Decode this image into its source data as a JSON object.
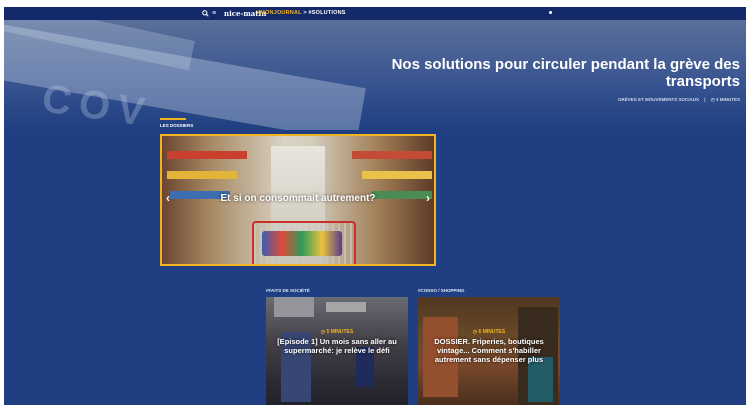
{
  "topbar": {
    "search_icon": "search-icon",
    "menu_icon": "menu-icon",
    "logo": "nice-matin",
    "crumb_primary": "#MONJOURNAL",
    "crumb_sep": ">",
    "crumb_secondary": "#SOLUTIONS"
  },
  "hero": {
    "title": "Nos solutions pour circuler pendant la grève des transports",
    "category": "GRÈVES ET MOUVEMENTS SOCIAUX",
    "clock_icon": "clock-icon",
    "read_time": "3 MINUTES",
    "background_word": "COV"
  },
  "section": {
    "label": "LES DOSSIERS"
  },
  "dossier": {
    "title": "Et si on consommait autrement?",
    "prev_icon": "chevron-left-icon",
    "next_icon": "chevron-right-icon"
  },
  "cards": [
    {
      "category": "#FAITS DE SOCIÉTÉ",
      "time": "◷ 5 MINUTES",
      "text": "[Episode 1] Un mois sans aller au supermarché: je relève le défi"
    },
    {
      "category": "#CONSO / SHOPPING",
      "time": "◷ 6 MINUTES",
      "text": "DOSSIER. Friperies, boutiques vintage... Comment s'habiller autrement sans dépenser plus"
    }
  ],
  "colors": {
    "background": "#1f3f82",
    "accent": "#f2b521",
    "topbar": "#13296a"
  }
}
